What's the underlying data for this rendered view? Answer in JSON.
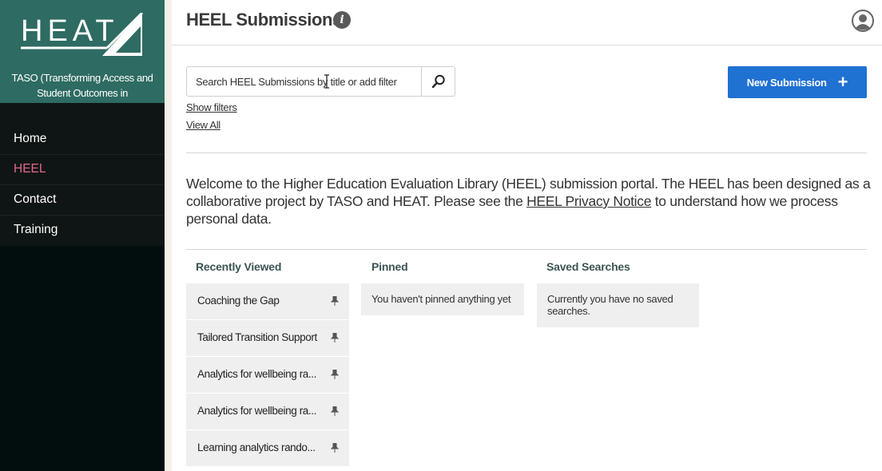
{
  "app": {
    "logo_text": "HEAT",
    "org_name": "TASO (Transforming Access and Student Outcomes in"
  },
  "sidebar": {
    "items": [
      {
        "label": "Home",
        "active": false
      },
      {
        "label": "HEEL",
        "active": true
      },
      {
        "label": "Contact",
        "active": false
      },
      {
        "label": "Training",
        "active": false
      }
    ]
  },
  "header": {
    "title": "HEEL Submissions"
  },
  "search": {
    "placeholder": "Search HEEL Submissions by title or add filter"
  },
  "links": {
    "show_filters": "Show filters",
    "view_all": "View All"
  },
  "actions": {
    "new_submission": "New Submission"
  },
  "welcome": {
    "before_link": "Welcome to the Higher Education Evaluation Library (HEEL) submission portal. The HEEL has been designed as a collaborative project by TASO and HEAT. Please see the ",
    "link": "HEEL Privacy Notice",
    "after_link": " to understand how we process personal data."
  },
  "panels": {
    "recently_viewed": {
      "title": "Recently Viewed",
      "items": [
        "Coaching the Gap",
        "Tailored Transition Support",
        "Analytics for wellbeing ra...",
        "Analytics for wellbeing ra...",
        "Learning analytics rando..."
      ]
    },
    "pinned": {
      "title": "Pinned",
      "empty": "You haven't pinned anything yet"
    },
    "saved_searches": {
      "title": "Saved Searches",
      "empty": "Currently you have no saved searches."
    }
  },
  "colors": {
    "brand": "#2e6b62",
    "sidebar_bg": "#0f1514",
    "active_nav": "#e0688e",
    "primary_button": "#1f71d2",
    "panel_bg": "#efefef"
  }
}
